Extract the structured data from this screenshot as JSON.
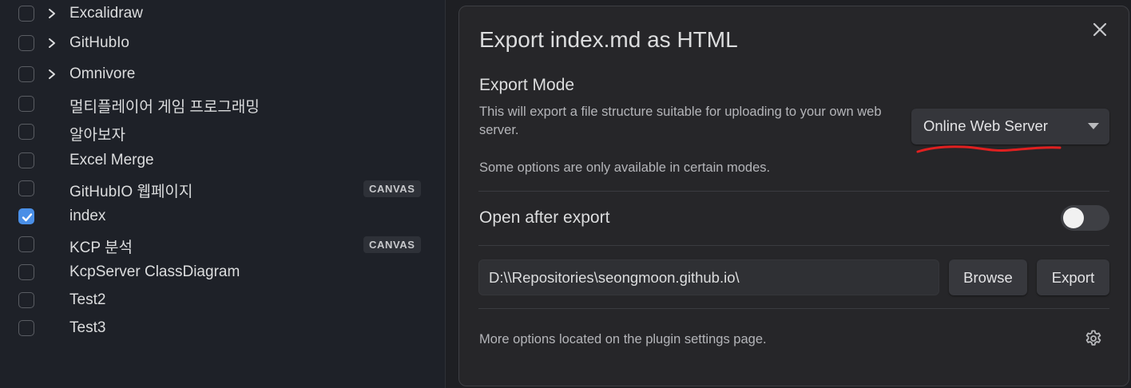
{
  "file_list": {
    "items": [
      {
        "label": "Excalidraw",
        "checked": false,
        "folder": true,
        "badge": ""
      },
      {
        "label": "GitHubIo",
        "checked": false,
        "folder": true,
        "badge": ""
      },
      {
        "label": "Omnivore",
        "checked": false,
        "folder": true,
        "badge": ""
      },
      {
        "label": "멀티플레이어 게임 프로그래밍",
        "checked": false,
        "folder": false,
        "badge": ""
      },
      {
        "label": "알아보자",
        "checked": false,
        "folder": false,
        "badge": ""
      },
      {
        "label": "Excel Merge",
        "checked": false,
        "folder": false,
        "badge": ""
      },
      {
        "label": "GitHubIO 웹페이지",
        "checked": false,
        "folder": false,
        "badge": "CANVAS"
      },
      {
        "label": "index",
        "checked": true,
        "folder": false,
        "badge": ""
      },
      {
        "label": "KCP 분석",
        "checked": false,
        "folder": false,
        "badge": "CANVAS"
      },
      {
        "label": "KcpServer ClassDiagram",
        "checked": false,
        "folder": false,
        "badge": ""
      },
      {
        "label": "Test2",
        "checked": false,
        "folder": false,
        "badge": ""
      },
      {
        "label": "Test3",
        "checked": false,
        "folder": false,
        "badge": ""
      }
    ]
  },
  "modal": {
    "title": "Export index.md as HTML",
    "export_mode": {
      "heading": "Export Mode",
      "description": "This will export a file structure suitable for uploading to your own web server.",
      "selected": "Online Web Server",
      "note": "Some options are only available in certain modes."
    },
    "open_after_export": {
      "label": "Open after export",
      "enabled": false
    },
    "path_value": "D:\\\\Repositories\\seongmoon.github.io\\",
    "browse_label": "Browse",
    "export_label": "Export",
    "footer_note": "More options located on the plugin settings page."
  },
  "colors": {
    "accent": "#4a8fe7",
    "annotation": "#e02020"
  },
  "icons": {
    "close": "close-icon",
    "caret": "chevron-down-icon",
    "folder_chevron": "chevron-right-icon",
    "check": "check-icon",
    "settings": "gear-icon"
  }
}
